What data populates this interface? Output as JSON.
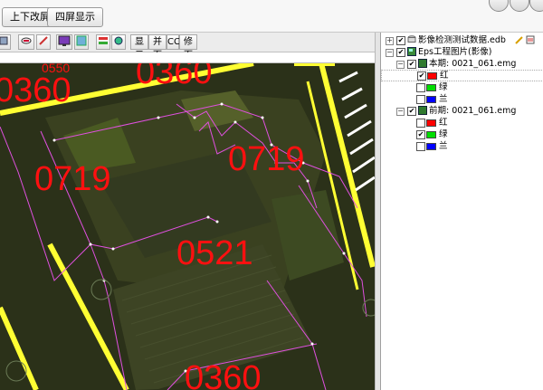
{
  "toolbar_top": {
    "btn_updown": "上下改屏",
    "btn_four": "四屏显示"
  },
  "map_toolbar": {
    "btn_display": "显示",
    "btn_merge": "并面",
    "btn_cc": "CC",
    "btn_repair": "修面"
  },
  "map": {
    "labels": {
      "l1": "0550",
      "l2": "0360",
      "l3": "0360",
      "l4": "0719",
      "l5": "0719",
      "l6": "0521",
      "l7": "0360"
    },
    "colors": {
      "road": "#ffff33",
      "parcel": "#e050e0",
      "label": "#ff1010"
    }
  },
  "layers": {
    "root": "影像检测测试数据.edb",
    "project": "Eps工程图片(影像)",
    "current": {
      "label": "本期: 0021_061.emg",
      "bands": [
        {
          "label": "红",
          "color": "#ff0000",
          "checked": true
        },
        {
          "label": "绿",
          "color": "#00dd00",
          "checked": false
        },
        {
          "label": "兰",
          "color": "#0000ff",
          "checked": false
        }
      ]
    },
    "previous": {
      "label": "前期: 0021_061.emg",
      "bands": [
        {
          "label": "红",
          "color": "#ff0000",
          "checked": false
        },
        {
          "label": "绿",
          "color": "#00dd00",
          "checked": true
        },
        {
          "label": "兰",
          "color": "#0000ff",
          "checked": false
        }
      ]
    }
  }
}
